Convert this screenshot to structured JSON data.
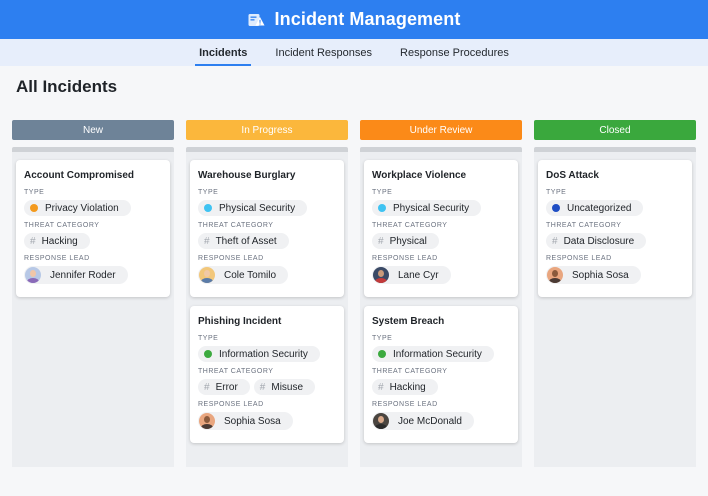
{
  "app": {
    "title": "Incident Management"
  },
  "tabs": [
    {
      "label": "Incidents",
      "active": true
    },
    {
      "label": "Incident Responses",
      "active": false
    },
    {
      "label": "Response Procedures",
      "active": false
    }
  ],
  "page": {
    "title": "All Incidents"
  },
  "labels": {
    "type": "TYPE",
    "threat_category": "THREAT CATEGORY",
    "response_lead": "RESPONSE LEAD"
  },
  "colors": {
    "brand": "#2d7ff0",
    "new": "#6e8398",
    "in_progress": "#fbb73c",
    "under_review": "#fb8a18",
    "closed": "#3aa83d",
    "privacy_violation": "#f39a1e",
    "physical_security": "#3fc3f2",
    "information_security": "#3caa3f",
    "uncategorized": "#1f4ec4"
  },
  "columns": [
    {
      "name": "New",
      "cards": [
        {
          "title": "Account Compromised",
          "type": "Privacy Violation",
          "type_icon": "orange-dot-icon",
          "threats": [
            "Hacking"
          ],
          "lead": "Jennifer Roder",
          "avatar_icon": "person-avatar-icon"
        }
      ]
    },
    {
      "name": "In Progress",
      "cards": [
        {
          "title": "Warehouse Burglary",
          "type": "Physical Security",
          "type_icon": "light-blue-dot-icon",
          "threats": [
            "Theft of Asset"
          ],
          "lead": "Cole Tomilo",
          "avatar_icon": "person-avatar-icon"
        },
        {
          "title": "Phishing Incident",
          "type": "Information Security",
          "type_icon": "green-dot-icon",
          "threats": [
            "Error",
            "Misuse"
          ],
          "lead": "Sophia Sosa",
          "avatar_icon": "person-avatar-icon"
        }
      ]
    },
    {
      "name": "Under Review",
      "cards": [
        {
          "title": "Workplace Violence",
          "type": "Physical Security",
          "type_icon": "light-blue-dot-icon",
          "threats": [
            "Physical"
          ],
          "lead": "Lane Cyr",
          "avatar_icon": "person-avatar-icon"
        },
        {
          "title": "System Breach",
          "type": "Information Security",
          "type_icon": "green-dot-icon",
          "threats": [
            "Hacking"
          ],
          "lead": "Joe McDonald",
          "avatar_icon": "person-avatar-icon"
        }
      ]
    },
    {
      "name": "Closed",
      "cards": [
        {
          "title": "DoS Attack",
          "type": "Uncategorized",
          "type_icon": "dark-blue-dot-icon",
          "threats": [
            "Data Disclosure"
          ],
          "lead": "Sophia Sosa",
          "avatar_icon": "person-avatar-icon"
        }
      ]
    }
  ]
}
